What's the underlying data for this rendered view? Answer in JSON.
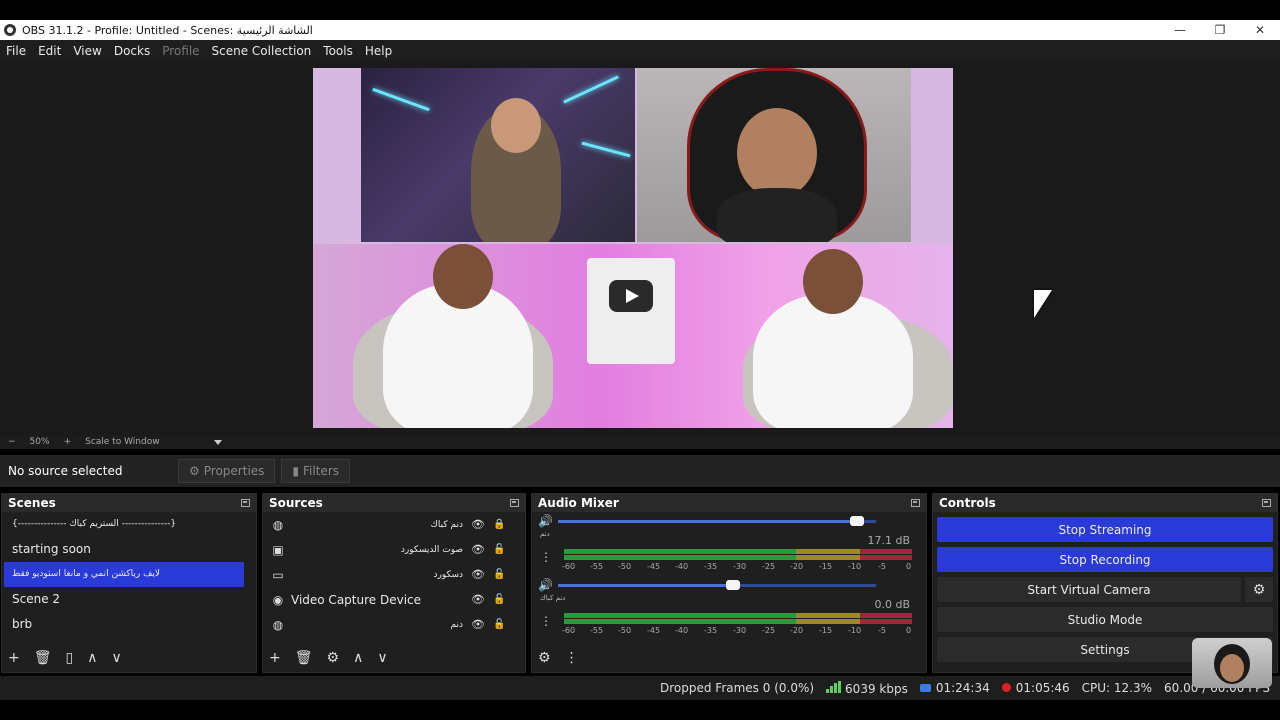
{
  "window": {
    "title": "OBS 31.1.2 - Profile: Untitled - Scenes: الشاشة الرئيسية",
    "minimize": "—",
    "maximize": "❐",
    "close": "✕"
  },
  "menu": [
    "File",
    "Edit",
    "View",
    "Docks",
    "Profile",
    "Scene Collection",
    "Tools",
    "Help"
  ],
  "preview": {
    "zoom_minus": "−",
    "zoom_value": "50%",
    "zoom_plus": "+",
    "scale_mode": "Scale to Window"
  },
  "toolbar": {
    "no_source": "No source selected",
    "properties": "Properties",
    "filters": "Filters"
  },
  "scenes": {
    "title": "Scenes",
    "items": [
      "{--------------- الستريم كباك ---------------}",
      "starting soon",
      "لايف رياكشن انمي و مانغا  استوديو فقط",
      "Scene 2",
      "brb"
    ]
  },
  "sources": {
    "title": "Sources",
    "items": [
      {
        "name": "دنم كباك",
        "icon": "globe-icon"
      },
      {
        "name": "صوت الديسكورد",
        "icon": "window-capture-icon"
      },
      {
        "name": "دسكورد",
        "icon": "display-capture-icon"
      },
      {
        "name": "Video Capture Device",
        "icon": "camera-icon"
      },
      {
        "name": "دنم",
        "icon": "globe-icon"
      }
    ]
  },
  "mixer": {
    "title": "Audio Mixer",
    "channels": [
      {
        "label": "دنم",
        "db": "17.1 dB",
        "volume": 0.94
      },
      {
        "label": "دنم كباك",
        "db": "0.0 dB",
        "volume": 0.55
      }
    ],
    "ticks": [
      "-60",
      "-55",
      "-50",
      "-45",
      "-40",
      "-35",
      "-30",
      "-25",
      "-20",
      "-15",
      "-10",
      "-5",
      "0"
    ]
  },
  "controls": {
    "title": "Controls",
    "stop_streaming": "Stop Streaming",
    "stop_recording": "Stop Recording",
    "start_virtual_camera": "Start Virtual Camera",
    "studio_mode": "Studio Mode",
    "settings": "Settings",
    "active_color": "#2a3ad6"
  },
  "status": {
    "dropped_frames": "Dropped Frames 0 (0.0%)",
    "bitrate": "6039 kbps",
    "stream_time": "01:24:34",
    "rec_time": "01:05:46",
    "cpu": "CPU: 12.3%",
    "fps": "60.00 / 60.00 FPS"
  }
}
